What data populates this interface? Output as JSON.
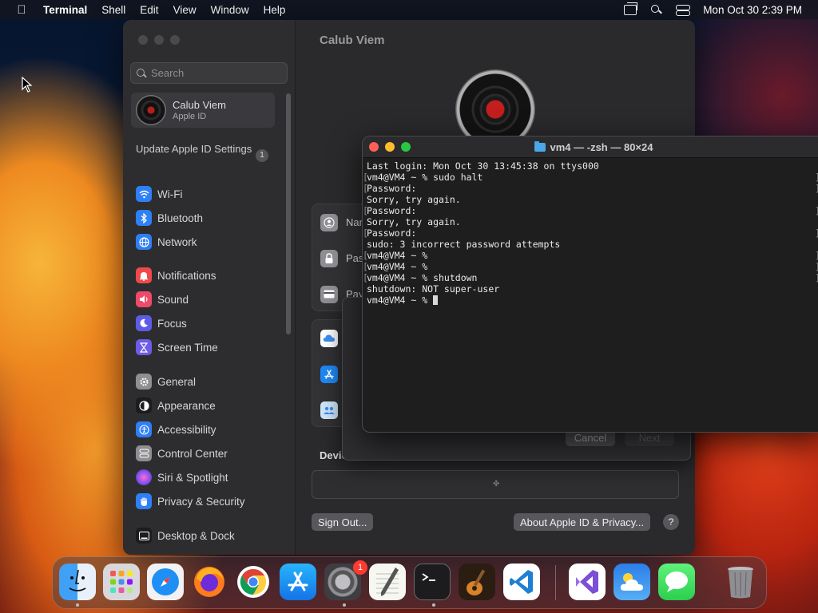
{
  "menubar": {
    "app": "Terminal",
    "items": [
      "Shell",
      "Edit",
      "View",
      "Window",
      "Help"
    ],
    "datetime": "Mon Oct 30  2:39 PM"
  },
  "settings": {
    "search_placeholder": "Search",
    "account_name": "Calub Viem",
    "account_sub": "Apple ID",
    "update_label": "Update Apple ID Settings",
    "update_count": "1",
    "nav": [
      {
        "label": "Wi-Fi",
        "icon": "wifi-icon",
        "color": "#2f7ff6"
      },
      {
        "label": "Bluetooth",
        "icon": "bluetooth-icon",
        "color": "#2f7ff6"
      },
      {
        "label": "Network",
        "icon": "globe-icon",
        "color": "#2f7ff6"
      },
      {
        "label": "Notifications",
        "icon": "bell-icon",
        "color": "#ee4a4a"
      },
      {
        "label": "Sound",
        "icon": "speaker-icon",
        "color": "#ee4a6a"
      },
      {
        "label": "Focus",
        "icon": "moon-icon",
        "color": "#5e5ce6"
      },
      {
        "label": "Screen Time",
        "icon": "hourglass-icon",
        "color": "#6c5ce7"
      },
      {
        "label": "General",
        "icon": "gear-icon",
        "color": "#8e8e93"
      },
      {
        "label": "Appearance",
        "icon": "appearance-icon",
        "color": "#1c1c1e"
      },
      {
        "label": "Accessibility",
        "icon": "accessibility-icon",
        "color": "#2f7ff6"
      },
      {
        "label": "Control Center",
        "icon": "control-center-icon",
        "color": "#8e8e93"
      },
      {
        "label": "Siri & Spotlight",
        "icon": "siri-icon",
        "color": "#b04ad8"
      },
      {
        "label": "Privacy & Security",
        "icon": "hand-icon",
        "color": "#2f7ff6"
      },
      {
        "label": "Desktop & Dock",
        "icon": "dock-icon",
        "color": "#1c1c1e"
      }
    ],
    "title": "Calub Viem",
    "card1": [
      "Nar",
      "Pas",
      "Pay"
    ],
    "devices_label": "Devic",
    "sign_out": "Sign Out...",
    "about": "About Apple ID & Privacy...",
    "help": "?",
    "sheet_cancel": "Cancel",
    "sheet_next": "Next"
  },
  "terminal": {
    "title": "vm4 — -zsh — 80×24",
    "lines": [
      "Last login: Mon Oct 30 13:45:38 on ttys000",
      "vm4@VM4 ~ % sudo halt",
      "Password:",
      "Sorry, try again.",
      "Password:",
      "Sorry, try again.",
      "Password:",
      "sudo: 3 incorrect password attempts",
      "vm4@VM4 ~ %",
      "vm4@VM4 ~ %",
      "vm4@VM4 ~ % shutdown",
      "shutdown: NOT super-user",
      "vm4@VM4 ~ % "
    ]
  },
  "dock": {
    "settings_badge": "1",
    "apps": [
      "finder-icon",
      "launchpad-icon",
      "safari-icon",
      "firefox-icon",
      "chrome-icon",
      "app-store-icon",
      "system-settings-icon",
      "textedit-icon",
      "terminal-icon",
      "garageband-icon",
      "vscode-icon",
      "visual-studio-icon",
      "weather-icon",
      "messages-icon",
      "trash-icon"
    ]
  }
}
